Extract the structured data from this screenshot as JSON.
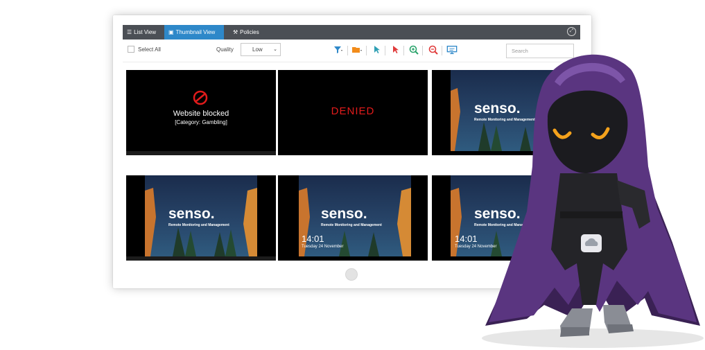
{
  "tabs": [
    {
      "label": "List View",
      "icon": "list-icon"
    },
    {
      "label": "Thumbnail View",
      "icon": "monitor-icon",
      "active": true
    },
    {
      "label": "Policies",
      "icon": "wrench-icon"
    }
  ],
  "toolbar": {
    "select_all_label": "Select All",
    "quality_label": "Quality",
    "quality_value": "Low",
    "search_placeholder": "Search",
    "tools": [
      "filter-icon",
      "folder-icon",
      "pointer-blue-icon",
      "pointer-red-icon",
      "zoom-in-icon",
      "zoom-out-icon",
      "remote-desktop-icon"
    ]
  },
  "thumbnails": {
    "blocked": {
      "title": "Website blocked",
      "subtitle": "[Category: Gambling]"
    },
    "denied": {
      "text": "DENIED"
    },
    "desktop": {
      "brand": "senso.",
      "tagline": "Remote Monitoring and Management"
    },
    "lock": {
      "time": "14:01",
      "date": "Tuesday 24 November"
    }
  },
  "colors": {
    "tabbar": "#4b4f55",
    "active_tab": "#2e88c9",
    "denied": "#e21b1b",
    "brand_cloud": "#3aa7e0",
    "cloak": "#4b2b6a"
  }
}
